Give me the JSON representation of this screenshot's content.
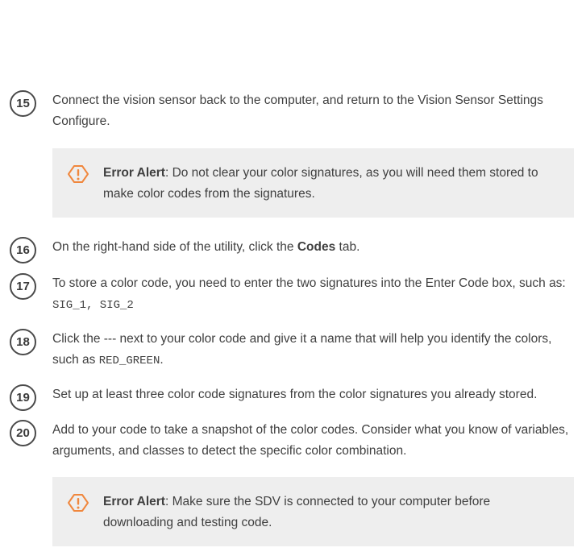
{
  "steps": [
    {
      "number": "15",
      "text": "Connect the vision sensor back to the computer, and return to the Vision Sensor Settings Configure."
    },
    {
      "number": "16",
      "pre": "On the right-hand side of the utility, click the ",
      "bold": "Codes",
      "post": " tab."
    },
    {
      "number": "17",
      "text": "To store a color code, you need to enter the two signatures into the Enter Code box, such as: ",
      "code": "SIG_1, SIG_2"
    },
    {
      "number": "18",
      "text": "Click the --- next to your color code and give it a name that will help you identify the colors, such as ",
      "code": "RED_GREEN",
      "post": "."
    },
    {
      "number": "19",
      "text": "Set up at least three color code signatures from the color signatures you already stored."
    },
    {
      "number": "20",
      "text": "Add to your code to take a snapshot of the color codes. Consider what you know of variables, arguments, and classes to detect the specific color combination."
    }
  ],
  "alerts": [
    {
      "label": "Error Alert",
      "text": ": Do not clear your color signatures, as you will need them stored to make color codes from the signatures."
    },
    {
      "label": "Error Alert",
      "text": ": Make sure the SDV is connected to your computer before downloading and testing code."
    }
  ],
  "colors": {
    "alert_icon": "#f0873d",
    "alert_bg": "#eeeeee",
    "text": "#3f3f3f"
  }
}
